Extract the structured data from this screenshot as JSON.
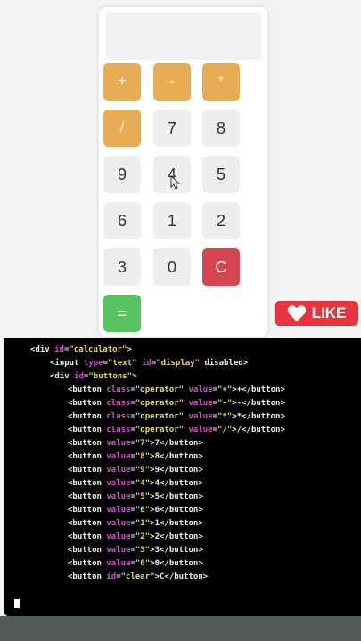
{
  "calculator": {
    "display_value": "",
    "buttons": [
      {
        "label": "+",
        "type": "operator"
      },
      {
        "label": "-",
        "type": "operator"
      },
      {
        "label": "*",
        "type": "operator"
      },
      {
        "label": "/",
        "type": "operator"
      },
      {
        "label": "7",
        "type": "number"
      },
      {
        "label": "8",
        "type": "number"
      },
      {
        "label": "9",
        "type": "number"
      },
      {
        "label": "4",
        "type": "number"
      },
      {
        "label": "5",
        "type": "number"
      },
      {
        "label": "6",
        "type": "number"
      },
      {
        "label": "1",
        "type": "number"
      },
      {
        "label": "2",
        "type": "number"
      },
      {
        "label": "3",
        "type": "number"
      },
      {
        "label": "0",
        "type": "number"
      },
      {
        "label": "C",
        "type": "clear"
      },
      {
        "label": "=",
        "type": "equals"
      }
    ]
  },
  "like_badge": {
    "label": "LIKE",
    "icon": "heart-icon"
  },
  "code": {
    "lines": [
      "<div id=\"calculator\">",
      "<input type=\"text\" id=\"display\" disabled>",
      "<div id=\"buttons\">",
      "<button class=\"operator\" value=\"+\">+</button>",
      "<button class=\"operator\" value=\"-\">-</button>",
      "<button class=\"operator\" value=\"*\">*</button>",
      "<button class=\"operator\" value=\"/\">/</button>",
      "<button value=\"7\">7</button>",
      "<button value=\"8\">8</button>",
      "<button value=\"9\">9</button>",
      "<button value=\"4\">4</button>",
      "<button value=\"5\">5</button>",
      "<button value=\"6\">6</button>",
      "<button value=\"1\">1</button>",
      "<button value=\"2\">2</button>",
      "<button value=\"3\">3</button>",
      "<button value=\"0\">0</button>",
      "<button id=\"clear\">C</button>"
    ]
  },
  "colors": {
    "operator": "#e8ad52",
    "clear": "#d64450",
    "equals": "#58c45e",
    "number": "#eeeeee",
    "like": "#e7343f",
    "attr": "#d64fd1",
    "value": "#e6dd5a"
  }
}
